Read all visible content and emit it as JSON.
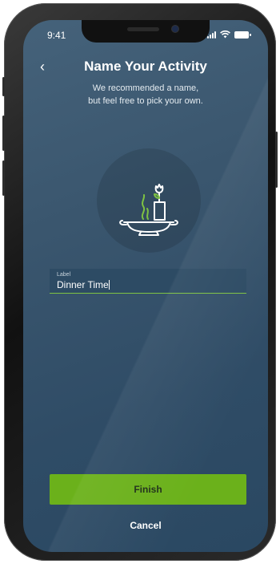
{
  "status_bar": {
    "time": "9:41"
  },
  "header": {
    "back_glyph": "‹",
    "title": "Name Your Activity",
    "subtitle_line1": "We recommended a name,",
    "subtitle_line2": "but feel free to pick your own."
  },
  "activity_icon": {
    "name": "dinner-vase-icon",
    "accent_color": "#7ec243"
  },
  "label_field": {
    "label": "Label",
    "value": "Dinner Time"
  },
  "actions": {
    "finish_label": "Finish",
    "cancel_label": "Cancel"
  },
  "colors": {
    "accent": "#6bb11b",
    "background": "#3a566e"
  }
}
